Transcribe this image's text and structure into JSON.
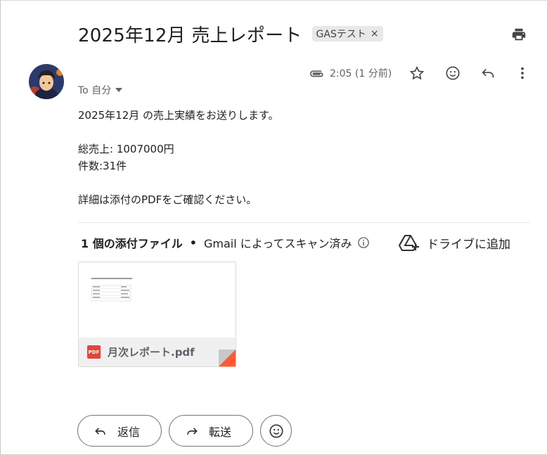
{
  "subject": "2025年12月 売上レポート",
  "label_chip": {
    "text": "GASテスト",
    "remove": "×"
  },
  "sender": {
    "to_text": "To 自分"
  },
  "meta": {
    "time": "2:05 (1 分前)"
  },
  "body": {
    "line1": "2025年12月 の売上実績をお送りします。",
    "line2": "総売上: 1007000円",
    "line3": "件数:31件",
    "line4": "詳細は添付のPDFをご確認ください。"
  },
  "attachments": {
    "count_text": "1 個の添付ファイル",
    "separator": "•",
    "scan_text": "Gmail によってスキャン済み",
    "drive_text": "ドライブに追加",
    "file": {
      "badge": "PDF",
      "name": "月次レポート.pdf"
    }
  },
  "actions": {
    "reply": "返信",
    "forward": "転送"
  },
  "icons": [
    "print-icon",
    "paperclip-icon",
    "star-icon",
    "emoji-icon",
    "reply-icon",
    "more-vert-icon",
    "info-icon",
    "add-to-drive-icon",
    "forward-icon"
  ],
  "colors": {
    "pdf_red": "#ea4335",
    "text": "#1f1f1f",
    "muted": "#5f6368"
  }
}
